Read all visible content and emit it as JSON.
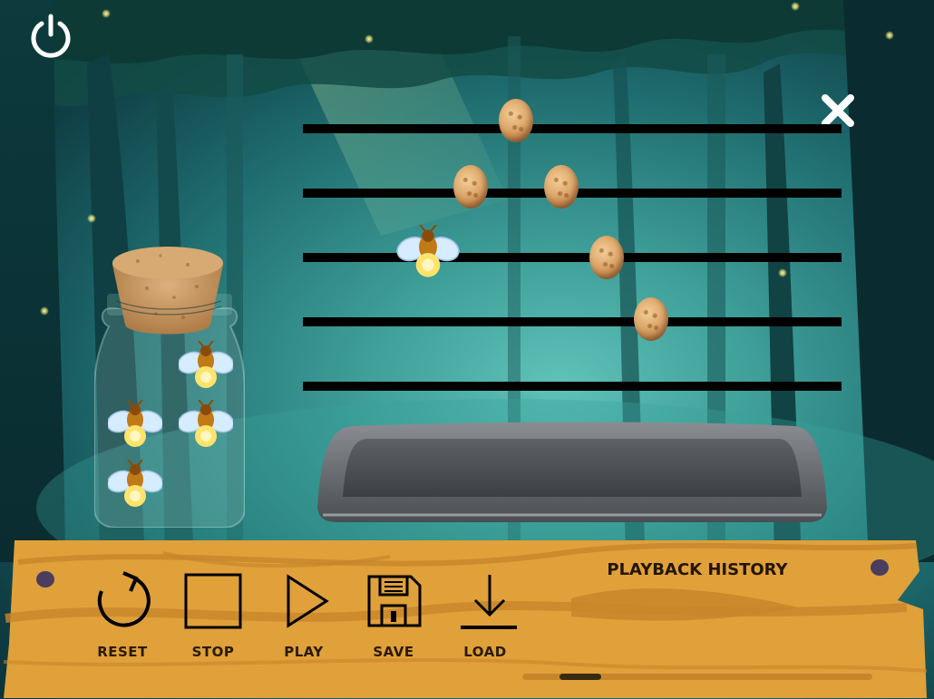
{
  "controls": {
    "reset_label": "RESET",
    "stop_label": "STOP",
    "play_label": "PLAY",
    "save_label": "SAVE",
    "load_label": "LOAD"
  },
  "history": {
    "title": "PLAYBACK HISTORY",
    "progress": 0.12
  },
  "icons": {
    "top_left": "power-icon",
    "top_right": "close-icon",
    "reset": "reset-icon",
    "stop": "stop-icon",
    "play": "play-icon",
    "save": "save-icon",
    "load": "load-icon"
  },
  "game": {
    "staff_lines": 5,
    "cookies_on_staff": 5,
    "fireflies_on_staff": 1,
    "fireflies_in_jar": 4
  },
  "colors": {
    "board": "#e0a03a",
    "board_dark": "#c8862b",
    "label_text": "#2a1a00",
    "staff_line": "#000000",
    "icon_white": "#ffffff"
  }
}
